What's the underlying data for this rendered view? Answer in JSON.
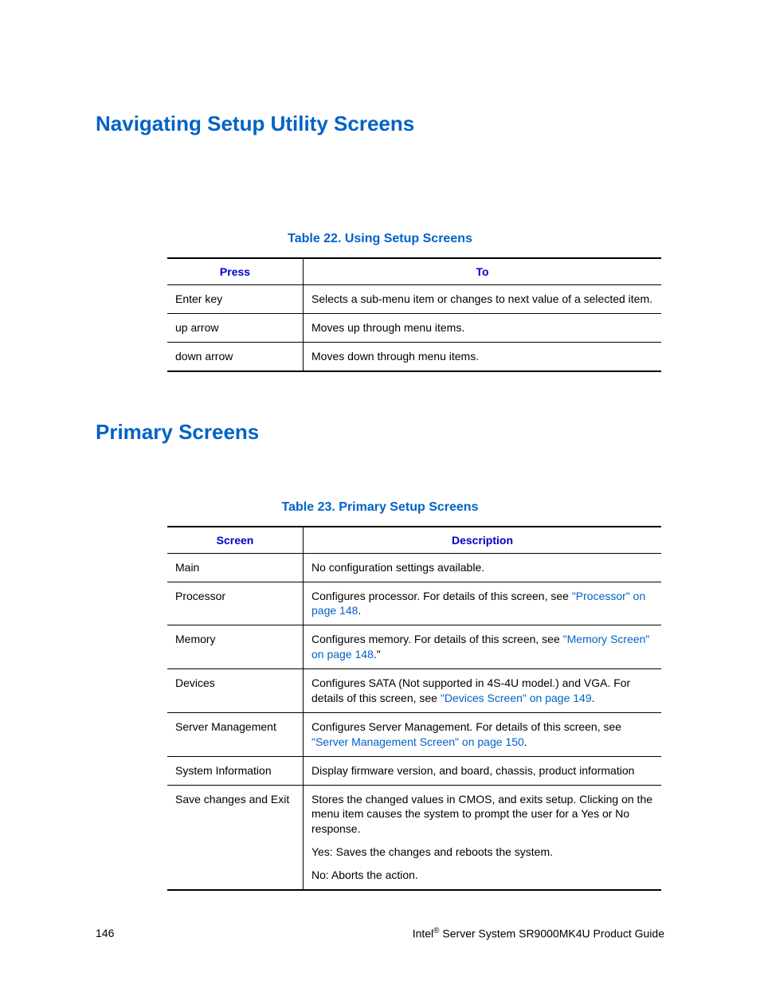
{
  "heading1": "Navigating Setup Utility Screens",
  "table22": {
    "caption": "Table 22. Using Setup Screens",
    "headers": {
      "c1": "Press",
      "c2": "To"
    },
    "rows": [
      {
        "press": "Enter key",
        "to": "Selects a sub-menu item or changes to next value of a selected item."
      },
      {
        "press": "up arrow",
        "to": "Moves up through menu items."
      },
      {
        "press": "down arrow",
        "to": "Moves down through menu items."
      }
    ]
  },
  "heading2": "Primary Screens",
  "table23": {
    "caption": "Table 23. Primary Setup Screens",
    "headers": {
      "c1": "Screen",
      "c2": "Description"
    },
    "rows": {
      "main": {
        "screen": "Main",
        "desc": "No configuration settings available."
      },
      "processor": {
        "screen": "Processor",
        "desc_pre": "Configures processor. For details of this screen, see ",
        "link": "\"Processor\" on page 148",
        "desc_post": "."
      },
      "memory": {
        "screen": "Memory",
        "desc_pre": "Configures memory. For details of this screen, see ",
        "link": "\"Memory Screen\" on page 148",
        "desc_post": ".\""
      },
      "devices": {
        "screen": "Devices",
        "desc_pre": "Configures SATA (Not supported in 4S-4U model.) and VGA. For details of this screen, see ",
        "link": "\"Devices Screen\" on page 149",
        "desc_post": "."
      },
      "server": {
        "screen": "Server Management",
        "desc_pre": "Configures Server Management. For details of this screen, see ",
        "link": "\"Server Management Screen\" on page 150",
        "desc_post": "."
      },
      "sysinfo": {
        "screen": "System Information",
        "desc": "Display firmware version, and board, chassis, product information"
      },
      "save": {
        "screen": "Save changes and Exit",
        "p1": "Stores the changed values in CMOS, and exits setup. Clicking on the menu item causes the system to prompt the user for a Yes or No response.",
        "p2": "Yes: Saves the changes and reboots the system.",
        "p3": "No: Aborts the action."
      }
    }
  },
  "footer": {
    "page": "146",
    "brand": "Intel",
    "reg": "®",
    "product": " Server System SR9000MK4U Product Guide"
  }
}
